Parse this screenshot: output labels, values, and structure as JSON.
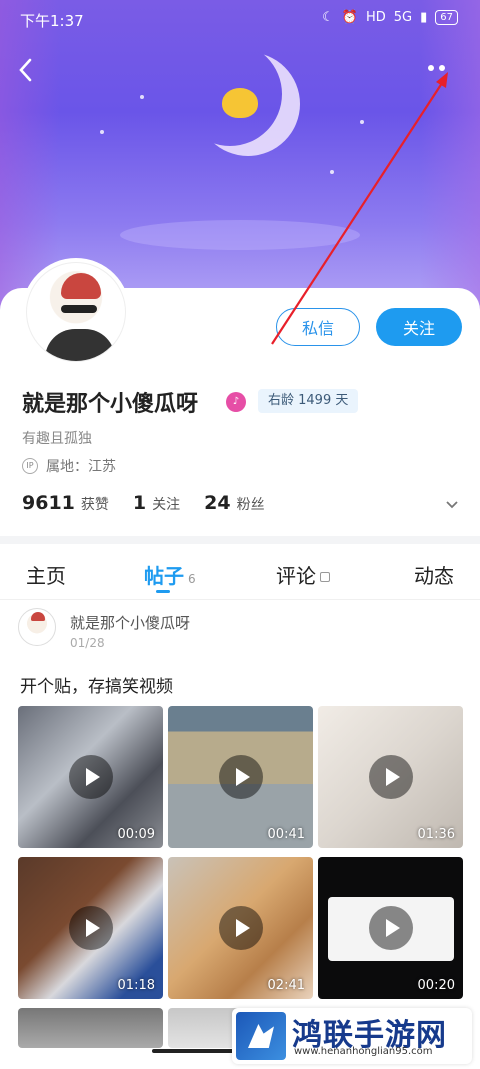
{
  "status_bar": {
    "time": "下午1:37",
    "network": "5G",
    "hd": "HD",
    "battery": "67"
  },
  "header": {
    "back_icon": "chevron-left-icon",
    "more_icon": "more-dots-icon"
  },
  "profile": {
    "name": "就是那个小傻瓜呀",
    "age_badge": "右龄 1499 天",
    "bio": "有趣且孤独",
    "ip_label": "属地：江苏",
    "ip_icon_text": "IP",
    "buttons": {
      "message": "私信",
      "follow": "关注"
    },
    "stats": [
      {
        "num": "9611",
        "label": "获赞"
      },
      {
        "num": "1",
        "label": "关注"
      },
      {
        "num": "24",
        "label": "粉丝"
      }
    ]
  },
  "tabs": [
    {
      "label": "主页"
    },
    {
      "label": "帖子",
      "count": "6"
    },
    {
      "label": "评论"
    },
    {
      "label": "动态"
    }
  ],
  "post": {
    "author": "就是那个小傻瓜呀",
    "date": "01/28",
    "title": "开个贴，存搞笑视频",
    "videos": [
      {
        "duration": "00:09"
      },
      {
        "duration": "00:41"
      },
      {
        "duration": "01:36"
      },
      {
        "duration": "01:18"
      },
      {
        "duration": "02:41"
      },
      {
        "duration": "00:20"
      }
    ]
  },
  "watermark": {
    "title": "鸿联手游网",
    "url": "www.henanhonglian95.com"
  },
  "colors": {
    "accent": "#1e9bf0",
    "banner": "#6a55e8",
    "arrow": "#e8202a"
  }
}
